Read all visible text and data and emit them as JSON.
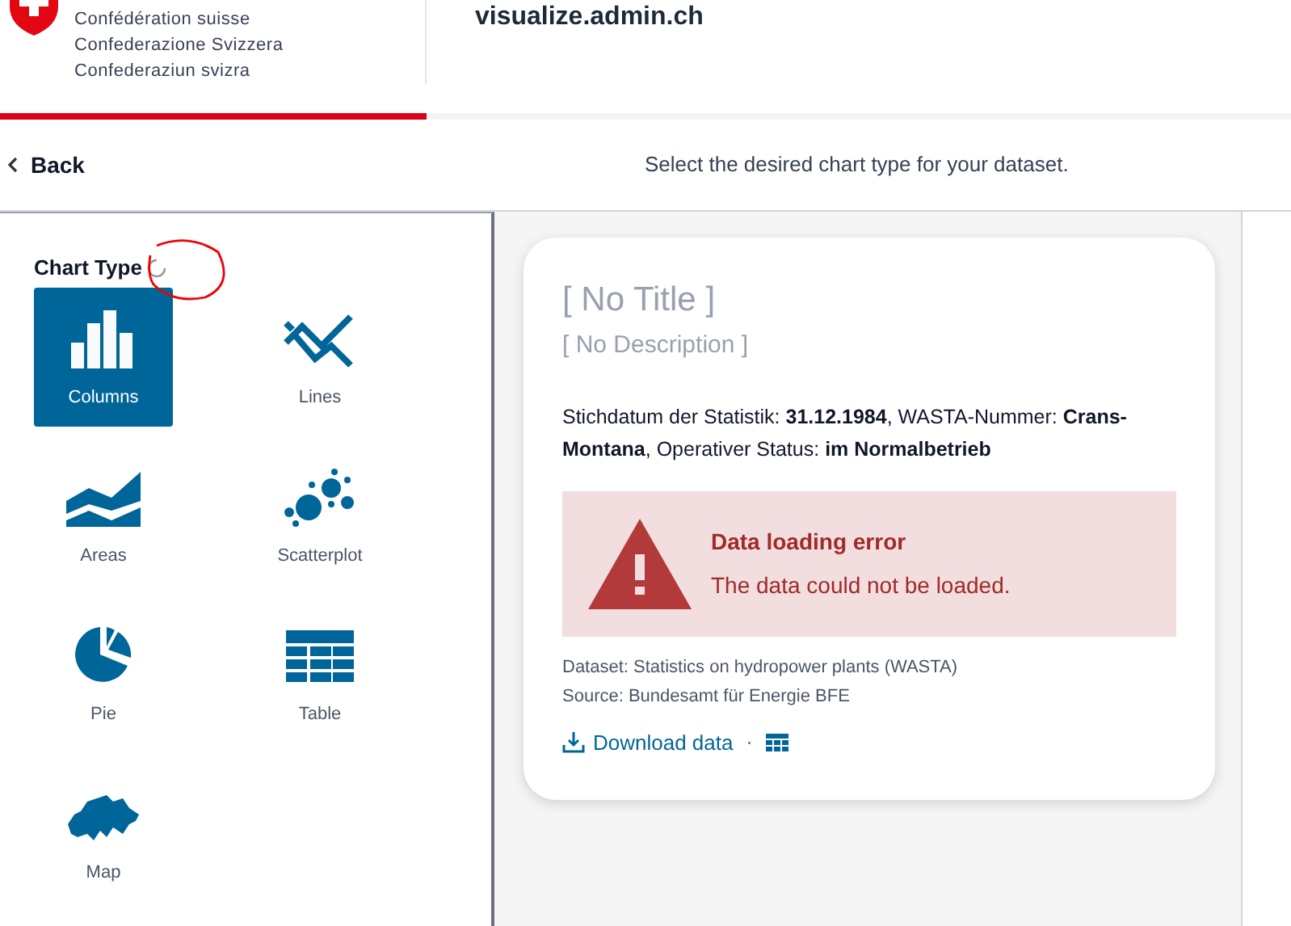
{
  "header": {
    "org_lines": [
      "Confédération suisse",
      "Confederazione Svizzera",
      "Confederaziun svizra"
    ],
    "site_title": "visualize.admin.ch"
  },
  "nav": {
    "back": "Back",
    "hint": "Select the desired chart type for your dataset."
  },
  "sidebar": {
    "title": "Chart Type",
    "loading": true,
    "items": [
      {
        "kind": "columns",
        "label": "Columns",
        "selected": true
      },
      {
        "kind": "lines",
        "label": "Lines",
        "selected": false
      },
      {
        "kind": "areas",
        "label": "Areas",
        "selected": false
      },
      {
        "kind": "scatterplot",
        "label": "Scatterplot",
        "selected": false
      },
      {
        "kind": "pie",
        "label": "Pie",
        "selected": false
      },
      {
        "kind": "table",
        "label": "Table",
        "selected": false
      },
      {
        "kind": "map",
        "label": "Map",
        "selected": false
      }
    ]
  },
  "card": {
    "title": "[ No Title ]",
    "description": "[ No Description ]",
    "filters": "Stichdatum der Statistik: **31.12.1984**, WASTA-Nummer: **Crans-Montana**, Operativer Status: **im Normalbetrieb**",
    "error": {
      "title": "Data loading error",
      "message": "The data could not be loaded."
    },
    "dataset": "Dataset: Statistics on hydropower plants (WASTA)",
    "source": "Source: Bundesamt für Energie BFE",
    "download": "Download data",
    "separator": "·"
  }
}
